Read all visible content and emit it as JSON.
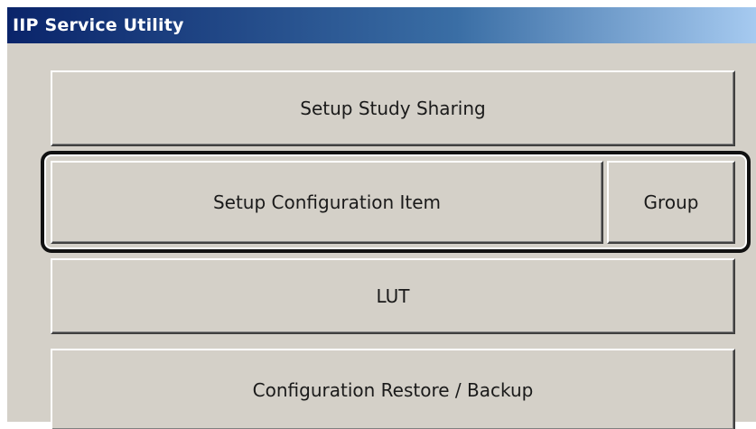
{
  "window": {
    "title": "IIP Service Utility"
  },
  "buttons": {
    "setup_study_sharing": "Setup Study Sharing",
    "setup_configuration_item": "Setup Configuration Item",
    "group": "Group",
    "lut": "LUT",
    "configuration_restore_backup": "Configuration Restore / Backup"
  },
  "colors": {
    "titlebar_start": "#0a246a",
    "titlebar_end": "#a6caf0",
    "face": "#d4d0c8",
    "highlight_border": "#111111"
  }
}
